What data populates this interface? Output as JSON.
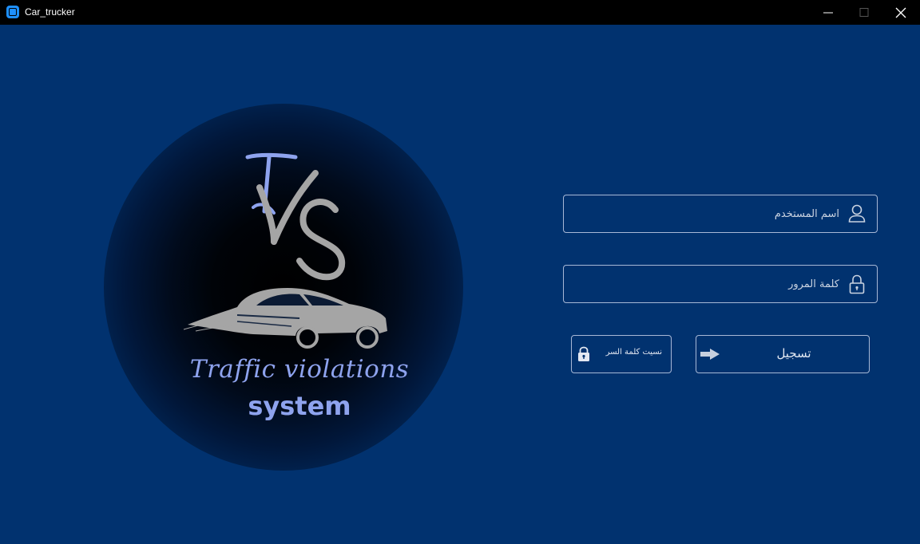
{
  "window": {
    "title": "Car_trucker"
  },
  "logo": {
    "monogram": "TVS",
    "title": "Traffic violations",
    "subtitle": "system"
  },
  "form": {
    "username": {
      "placeholder": "اسم المستخدم",
      "value": "",
      "icon": "user-icon"
    },
    "password": {
      "placeholder": "كلمة المرور",
      "value": "",
      "icon": "lock-icon"
    },
    "forgot_button": {
      "label": "نسيت كلمة السر",
      "icon": "lock-icon"
    },
    "login_button": {
      "label": "تسجيل",
      "icon": "login-arrow-icon"
    }
  },
  "colors": {
    "background": "#01326f",
    "titlebar": "#000000",
    "logo_text": "#8ea3ee",
    "logo_gray": "#a5a5a5",
    "border": "#a8b8d6"
  }
}
